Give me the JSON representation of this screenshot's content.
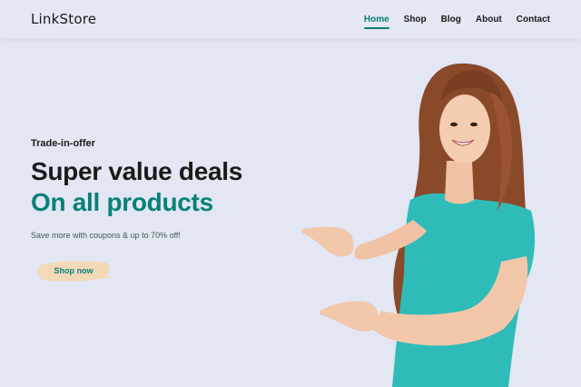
{
  "header": {
    "logo": "LinkStore",
    "nav": [
      {
        "label": "Home",
        "active": true
      },
      {
        "label": "Shop",
        "active": false
      },
      {
        "label": "Blog",
        "active": false
      },
      {
        "label": "About",
        "active": false
      },
      {
        "label": "Contact",
        "active": false
      }
    ]
  },
  "hero": {
    "tagline": "Trade-in-offer",
    "headline": "Super value deals",
    "headline_accent": "On all products",
    "subtext": "Save more with coupons & up to 70% off!",
    "cta_label": "Shop now"
  },
  "colors": {
    "accent": "#088178",
    "background": "#e3e6f3",
    "cta_brush": "#f3d9b8"
  }
}
